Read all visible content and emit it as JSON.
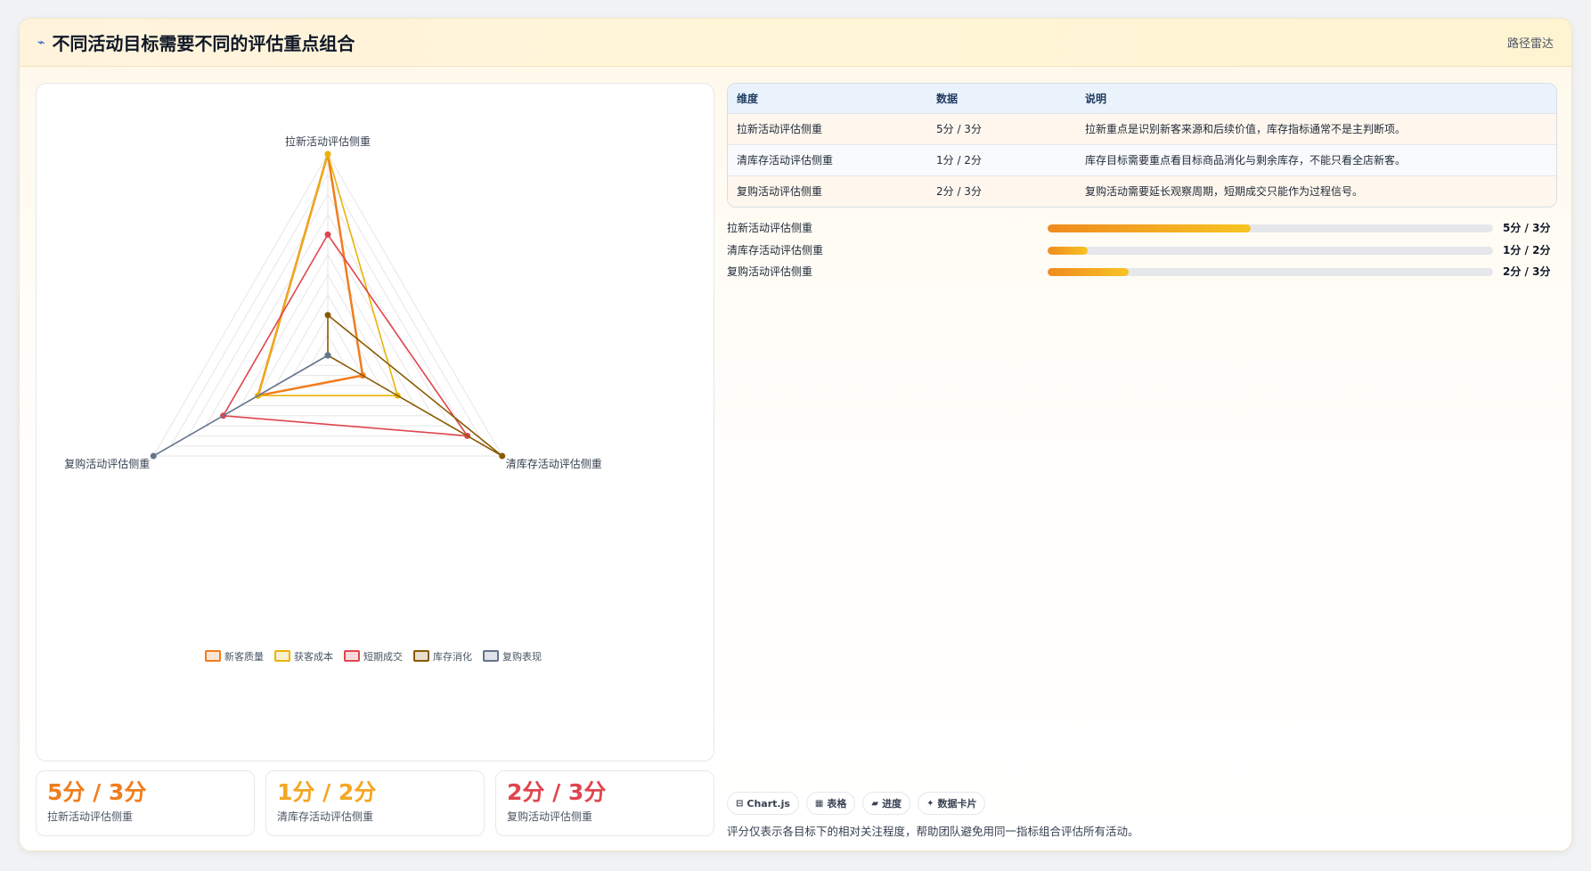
{
  "header": {
    "title": "不同活动目标需要不同的评估重点组合",
    "tag": "路径雷达"
  },
  "chart_data": {
    "type": "radar",
    "axes": [
      "拉新活动评估侧重",
      "清库存活动评估侧重",
      "复购活动评估侧重"
    ],
    "max": 5,
    "series": [
      {
        "name": "新客质量",
        "values": [
          5,
          1,
          2
        ],
        "color": "#f07d1e"
      },
      {
        "name": "获客成本",
        "values": [
          5,
          2,
          2
        ],
        "color": "#eab308"
      },
      {
        "name": "短期成交",
        "values": [
          3,
          4,
          3
        ],
        "color": "#e0454f"
      },
      {
        "name": "库存消化",
        "values": [
          1,
          5,
          0
        ],
        "color": "#8a5a00"
      },
      {
        "name": "复购表现",
        "values": [
          0,
          0,
          5
        ],
        "color": "#64748b"
      }
    ]
  },
  "table": {
    "headers": [
      "维度",
      "数据",
      "说明"
    ],
    "rows": [
      [
        "拉新活动评估侧重",
        "5分 / 3分",
        "拉新重点是识别新客来源和后续价值，库存指标通常不是主判断项。"
      ],
      [
        "清库存活动评估侧重",
        "1分 / 2分",
        "库存目标需要重点看目标商品消化与剩余库存，不能只看全店新客。"
      ],
      [
        "复购活动评估侧重",
        "2分 / 3分",
        "复购活动需要延长观察周期，短期成交只能作为过程信号。"
      ]
    ]
  },
  "bars": [
    {
      "label": "拉新活动评估侧重",
      "value": "5分 / 3分",
      "fraction": 0.455
    },
    {
      "label": "清库存活动评估侧重",
      "value": "1分 / 2分",
      "fraction": 0.09
    },
    {
      "label": "复购活动评估侧重",
      "value": "2分 / 3分",
      "fraction": 0.182
    }
  ],
  "kpis": [
    {
      "value": "5分 / 3分",
      "label": "拉新活动评估侧重",
      "color": "#f07d1e"
    },
    {
      "value": "1分 / 2分",
      "label": "清库存活动评估侧重",
      "color": "#f5a623"
    },
    {
      "value": "2分 / 3分",
      "label": "复购活动评估侧重",
      "color": "#e0454f"
    }
  ],
  "chips": [
    {
      "icon": "chart-icon",
      "label": "Chart.js"
    },
    {
      "icon": "table-icon",
      "label": "表格"
    },
    {
      "icon": "progress-icon",
      "label": "进度"
    },
    {
      "icon": "sparkle-icon",
      "label": "数据卡片"
    }
  ],
  "note": "评分仅表示各目标下的相对关注程度，帮助团队避免用同一指标组合评估所有活动。"
}
